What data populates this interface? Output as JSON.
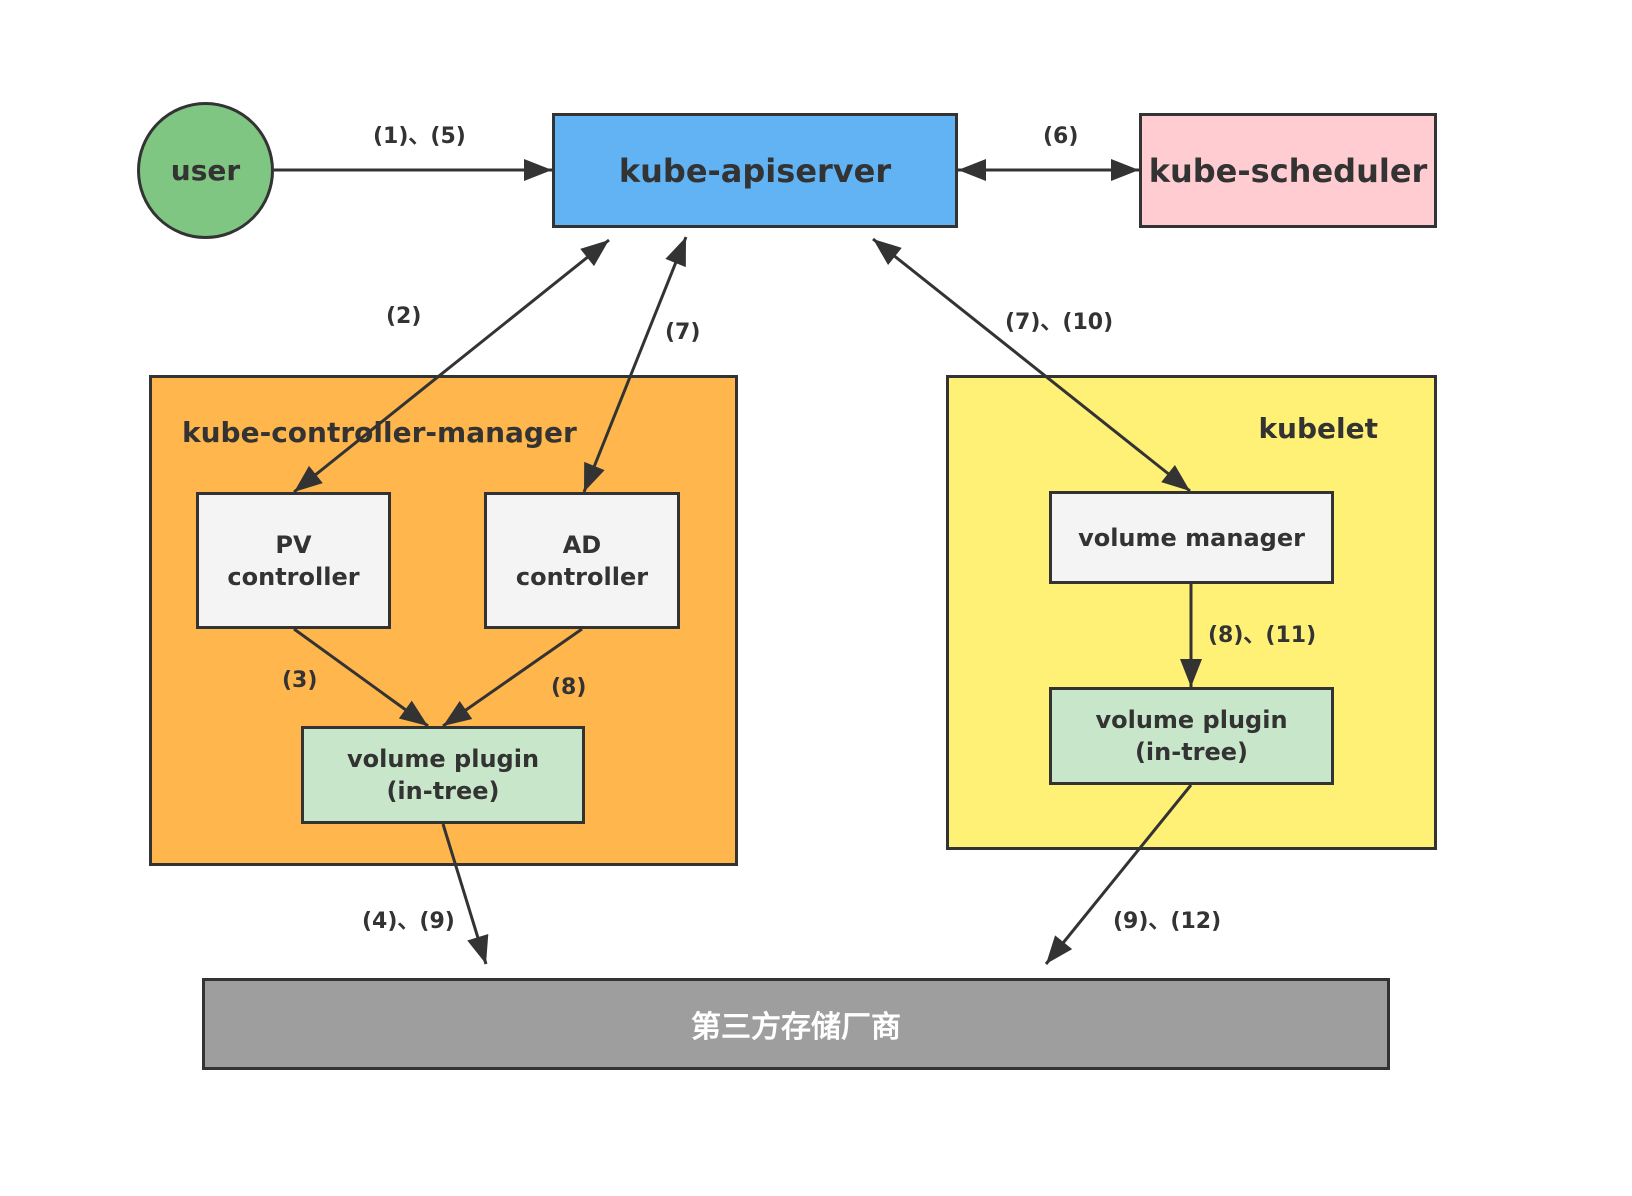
{
  "nodes": {
    "user": "user",
    "apiserver": "kube-apiserver",
    "scheduler": "kube-scheduler",
    "kcm": {
      "title": "kube-controller-manager",
      "pv_controller": [
        "PV",
        "controller"
      ],
      "ad_controller": [
        "AD",
        "controller"
      ],
      "volume_plugin": [
        "volume plugin",
        "(in-tree)"
      ]
    },
    "kubelet": {
      "title": "kubelet",
      "volume_manager": "volume manager",
      "volume_plugin": [
        "volume plugin",
        "(in-tree)"
      ]
    },
    "vendor": "第三方存储厂商"
  },
  "edges": [
    {
      "id": "user-apiserver",
      "label": "(1)、(5)",
      "direction": "forward"
    },
    {
      "id": "apiserver-scheduler",
      "label": "(6)",
      "direction": "both"
    },
    {
      "id": "apiserver-pv",
      "label": "(2)",
      "direction": "both"
    },
    {
      "id": "apiserver-ad",
      "label": "(7)",
      "direction": "both"
    },
    {
      "id": "apiserver-volmgr",
      "label": "(7)、(10)",
      "direction": "both"
    },
    {
      "id": "pv-plugin",
      "label": "(3)",
      "direction": "forward"
    },
    {
      "id": "ad-plugin",
      "label": "(8)",
      "direction": "forward"
    },
    {
      "id": "volmgr-plugin",
      "label": "(8)、(11)",
      "direction": "forward"
    },
    {
      "id": "kcm-plugin-vendor",
      "label": "(4)、(9)",
      "direction": "forward"
    },
    {
      "id": "kubelet-plugin-vendor",
      "label": "(9)、(12)",
      "direction": "forward"
    }
  ],
  "colors": {
    "user": "#80c683",
    "apiserver": "#61b3f4",
    "scheduler": "#ffccd1",
    "kcm": "#ffb74d",
    "kubelet": "#fff176",
    "inner_gray": "#f4f4f4",
    "plugin_green": "#c8e6ca",
    "vendor": "#9e9e9e",
    "stroke": "#333333"
  }
}
